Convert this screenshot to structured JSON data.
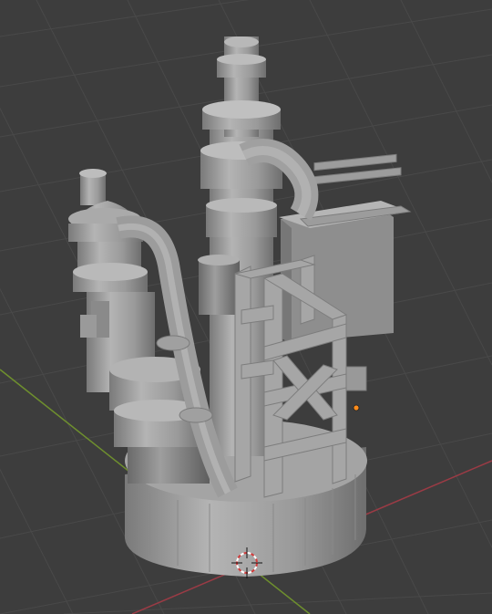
{
  "app": {
    "editor": "3D Viewport",
    "colors": {
      "background": "#3d3d3d",
      "grid": "#4a4a4a",
      "x_axis": "#9a3b45",
      "y_axis": "#6e8f2e",
      "mesh_light": "#a8a8a8",
      "mesh_mid": "#8c8c8c",
      "mesh_dark": "#6a6a6a",
      "origin_dot": "#ff8c1a"
    }
  },
  "scene": {
    "object": "industrial-tower-model",
    "shading": "solid",
    "selection": "none"
  },
  "widgets": {
    "cursor_icon": "3d-cursor-icon",
    "origin_icon": "object-origin-icon"
  }
}
